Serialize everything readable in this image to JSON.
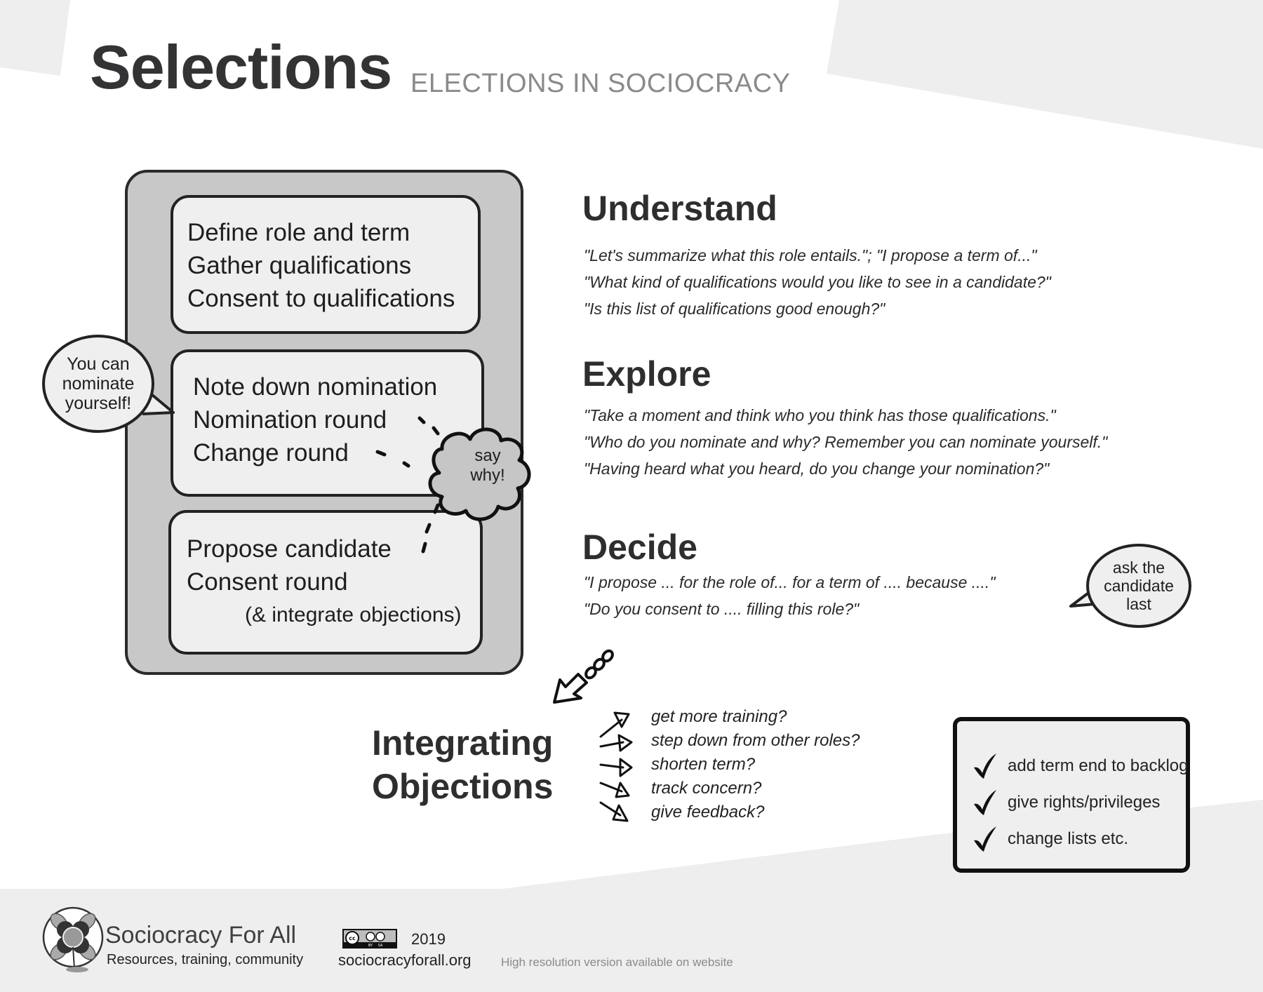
{
  "header": {
    "title": "Selections",
    "subtitle": "ELECTIONS IN SOCIOCRACY"
  },
  "process": {
    "steps": [
      {
        "lines": [
          "Define role and term",
          "Gather qualifications",
          "Consent to qualifications"
        ]
      },
      {
        "lines": [
          "Note down nomination",
          "Nomination round",
          "Change round"
        ]
      },
      {
        "lines": [
          "Propose candidate",
          "Consent round"
        ],
        "sub": "(& integrate objections)"
      }
    ],
    "nominate_bubble": [
      "You can",
      "nominate",
      "yourself!"
    ],
    "say_why_cloud": [
      "say",
      "why!"
    ]
  },
  "sections": {
    "understand": {
      "heading": "Understand",
      "quotes": [
        "\"Let's summarize what this role entails.\"; \"I propose a term of...\"",
        "\"What kind of qualifications would you like to see in a candidate?\"",
        "\"Is this list of qualifications good enough?\""
      ]
    },
    "explore": {
      "heading": "Explore",
      "quotes": [
        "\"Take a moment and think who you think has those qualifications.\"",
        "\"Who do you nominate and why? Remember you can nominate yourself.\"",
        "\"Having heard what you heard, do you change your nomination?\""
      ]
    },
    "decide": {
      "heading": "Decide",
      "quotes": [
        "\"I propose ... for the role of... for a term of .... because ....\"",
        "\"Do you consent to .... filling this role?\""
      ],
      "ask_bubble": [
        "ask the",
        "candidate",
        "last"
      ]
    }
  },
  "integrating": {
    "title_lines": [
      "Integrating",
      "Objections"
    ],
    "options": [
      "get more training?",
      "step down from other roles?",
      "shorten term?",
      "track concern?",
      "give feedback?"
    ]
  },
  "checklist": {
    "items": [
      "add term end to backlog",
      "give rights/privileges",
      "change lists etc."
    ]
  },
  "footer": {
    "org_name": "Sociocracy For All",
    "tagline": "Resources, training, community",
    "license": {
      "cc": "cc",
      "by": "BY",
      "sa": "SA"
    },
    "year": "2019",
    "website": "sociocracyforall.org",
    "hires_note": "High resolution version available on website"
  },
  "colors": {
    "background": "#ffffff",
    "panel_gray": "#eeeeee",
    "outer_box": "#c8c8c8",
    "inner_box": "#efefef",
    "ink": "#222222",
    "subtitle_gray": "#8a8a8a"
  }
}
